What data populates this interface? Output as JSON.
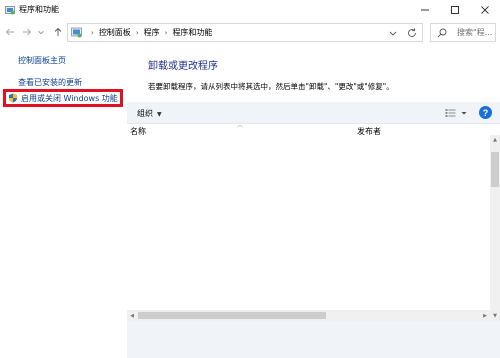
{
  "window": {
    "title": "程序和功能",
    "controls": [
      "minimize-icon",
      "maximize-icon",
      "close-icon"
    ]
  },
  "nav": {
    "back_icon": "arrow-left-icon",
    "forward_icon": "arrow-right-icon",
    "recent_icon": "chevron-down-icon",
    "up_icon": "arrow-up-icon"
  },
  "address": {
    "crumbs": [
      "控制面板",
      "程序",
      "程序和功能"
    ],
    "separator": "›"
  },
  "search": {
    "placeholder": "搜索\"程..."
  },
  "sidebar": {
    "home_link": "控制面板主页",
    "updates_link": "查看已安装的更新",
    "features_link": "启用或关闭 Windows 功能"
  },
  "main": {
    "title": "卸载或更改程序",
    "description": "若要卸载程序，请从列表中将其选中，然后单击\"卸载\"、\"更改\"或\"修复\"。",
    "organize_label": "组织",
    "columns": [
      "名称",
      "发布者"
    ],
    "help_label": "?"
  },
  "colors": {
    "link": "#0b3f8e",
    "title": "#1e3287",
    "highlight_border": "#e01025",
    "toolbar_bg": "#f0f4f9",
    "help_blue": "#1a6fd6"
  }
}
